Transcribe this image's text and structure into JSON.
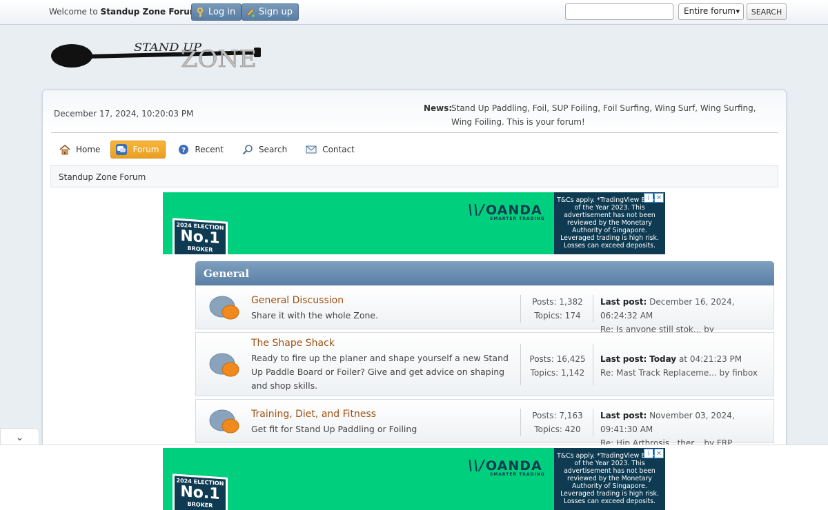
{
  "topbar": {
    "welcome_prefix": "Welcome to",
    "site_name": "Standup Zone Forum",
    "welcome_suffix": ".",
    "login_label": "Log in",
    "signup_label": "Sign up",
    "search_placeholder": "",
    "search_scope": "Entire forum",
    "search_button": "SEARCH"
  },
  "logo": {
    "line1": "STAND UP",
    "line2": "ZONE"
  },
  "upper": {
    "date": "December 17, 2024, 10:20:03 PM",
    "news_label": "News:",
    "news_text": "Stand Up Paddling, Foil, SUP Foiling, Foil Surfing, Wing Surf, Wing Surfing, Wing Foiling. This is your forum!"
  },
  "nav": {
    "home": "Home",
    "forum": "Forum",
    "recent": "Recent",
    "search": "Search",
    "contact": "Contact"
  },
  "linktree": "Standup Zone Forum",
  "ad": {
    "badge_top": "2024 ELECTION",
    "badge_num": "No.1",
    "badge_bottom": "BROKER",
    "brand": "OANDA",
    "brand_sub": "SMARTER TRADING",
    "disclaimer": "T&Cs apply. *TradingView Broker of the Year 2023. This advertisement has not been reviewed by the Monetary Authority of Singapore. Leveraged trading is high risk. Losses can exceed deposits.",
    "info_glyph": "i",
    "close_glyph": "✕"
  },
  "category": {
    "name": "General",
    "boards": [
      {
        "title": "General Discussion",
        "description": "Share it with the whole Zone.",
        "posts": "Posts: 1,382",
        "topics": "Topics: 174",
        "last_label": "Last post:",
        "last_when": "December 16, 2024, 06:24:32 AM",
        "last_re": "Re: Is anyone still stok... by APPST_Paddle"
      },
      {
        "title": "The Shape Shack",
        "description": "Ready to fire up the planer and shape yourself a new Stand Up Paddle Board or Foiler?  Give and get advice on shaping and shop skills.",
        "posts": "Posts: 16,425",
        "topics": "Topics: 1,142",
        "last_label": "Last post:",
        "last_today": "Today",
        "last_when": "at 04:21:23 PM",
        "last_re": "Re: Mast Track Replaceme... by finbox"
      },
      {
        "title": "Training, Diet, and Fitness",
        "description": "Get fit for Stand Up Paddling or Foiling",
        "posts": "Posts: 7,163",
        "topics": "Topics: 420",
        "last_label": "Last post:",
        "last_when": "November 03, 2024, 09:41:30 AM",
        "last_re": "Re: Hip Arthrosis...ther... by FRP"
      }
    ]
  },
  "collapse_glyph": "⌄"
}
